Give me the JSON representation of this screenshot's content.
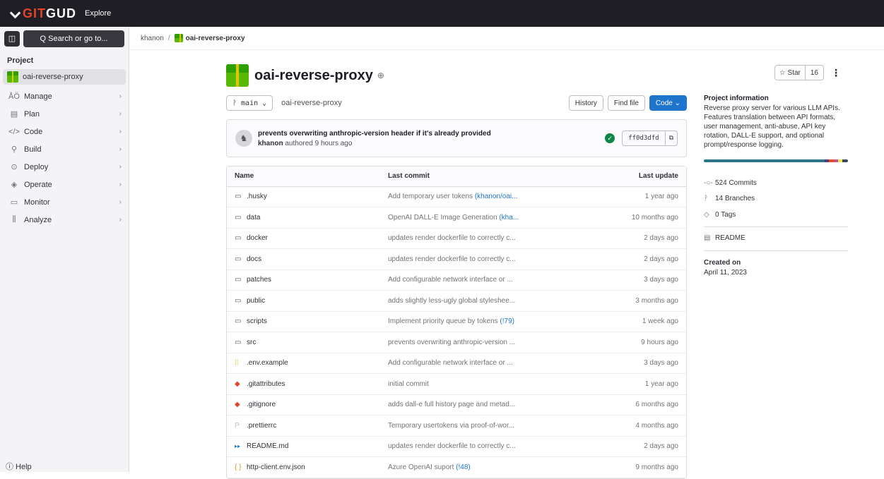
{
  "topbar": {
    "brand_prefix": "",
    "brand_git": "GIT",
    "brand_rest": "GUD",
    "explore": "Explore"
  },
  "sidebar": {
    "search_label": "Q Search or go to...",
    "section": "Project",
    "project": "oai-reverse-proxy",
    "items": [
      {
        "label": "Manage",
        "icon": "users-icon",
        "glyph": "ÅÖ"
      },
      {
        "label": "Plan",
        "icon": "calendar-icon",
        "glyph": "▤"
      },
      {
        "label": "Code",
        "icon": "code-icon",
        "glyph": "</>"
      },
      {
        "label": "Build",
        "icon": "rocket-icon",
        "glyph": "⚲"
      },
      {
        "label": "Deploy",
        "icon": "deploy-icon",
        "glyph": "⊙"
      },
      {
        "label": "Operate",
        "icon": "cloud-icon",
        "glyph": "◈"
      },
      {
        "label": "Monitor",
        "icon": "monitor-icon",
        "glyph": "▭"
      },
      {
        "label": "Analyze",
        "icon": "chart-icon",
        "glyph": "⫼"
      }
    ],
    "help": "ⓘ Help"
  },
  "breadcrumb": {
    "owner": "khanon",
    "separator": "/",
    "project": "oai-reverse-proxy"
  },
  "project": {
    "title": "oai-reverse-proxy",
    "branch": "main",
    "path": "oai-reverse-proxy",
    "history_label": "History",
    "find_file_label": "Find file",
    "code_label": "Code ⌄"
  },
  "last_commit": {
    "title": "prevents overwriting anthropic-version header if it's already provided",
    "author": "khanon",
    "meta": "authored 9 hours ago",
    "sha": "ff0d3dfd",
    "status": "passed"
  },
  "table": {
    "headers": {
      "name": "Name",
      "commit": "Last commit",
      "update": "Last update"
    },
    "rows": [
      {
        "name": ".husky",
        "type": "folder",
        "msg": "Add temporary user tokens ",
        "link": "(khanon/oai...",
        "updated": "1 year ago"
      },
      {
        "name": "data",
        "type": "folder",
        "msg": "OpenAI DALL-E Image Generation ",
        "link": "(kha...",
        "updated": "10 months ago"
      },
      {
        "name": "docker",
        "type": "folder",
        "msg": "updates render dockerfile to correctly c...",
        "link": "",
        "updated": "2 days ago"
      },
      {
        "name": "docs",
        "type": "folder",
        "msg": "updates render dockerfile to correctly c...",
        "link": "",
        "updated": "2 days ago"
      },
      {
        "name": "patches",
        "type": "folder",
        "msg": "Add configurable network interface or ...",
        "link": "",
        "updated": "3 days ago"
      },
      {
        "name": "public",
        "type": "folder",
        "msg": "adds slightly less-ugly global styleshee...",
        "link": "",
        "updated": "3 months ago"
      },
      {
        "name": "scripts",
        "type": "folder",
        "msg": "Implement priority queue by tokens ",
        "link": "(!79)",
        "updated": "1 week ago"
      },
      {
        "name": "src",
        "type": "folder",
        "msg": "prevents overwriting anthropic-version ...",
        "link": "",
        "updated": "9 hours ago"
      },
      {
        "name": ".env.example",
        "type": "env",
        "msg": "Add configurable network interface or ...",
        "link": "",
        "updated": "3 days ago"
      },
      {
        "name": ".gitattributes",
        "type": "git",
        "msg": "initial commit",
        "link": "",
        "updated": "1 year ago"
      },
      {
        "name": ".gitignore",
        "type": "git",
        "msg": "adds dall-e full history page and metad...",
        "link": "",
        "updated": "6 months ago"
      },
      {
        "name": ".prettierrc",
        "type": "prettier",
        "msg": "Temporary usertokens via proof-of-wor...",
        "link": "",
        "updated": "4 months ago"
      },
      {
        "name": "README.md",
        "type": "markdown",
        "msg": "updates render dockerfile to correctly c...",
        "link": "",
        "updated": "2 days ago"
      },
      {
        "name": "http-client.env.json",
        "type": "json",
        "msg": "Azure OpenAI suport ",
        "link": "(!48)",
        "updated": "9 months ago"
      }
    ]
  },
  "right": {
    "star_label": "☆ Star",
    "star_count": "16",
    "info_title": "Project information",
    "info_desc": "Reverse proxy server for various LLM APIs. Features translation between API formats, user management, anti-abuse, API key rotation, DALL-E support, and optional prompt/response logging.",
    "languages": [
      {
        "color": "#2b7489",
        "share": 0.84
      },
      {
        "color": "#563d7c",
        "share": 0.03
      },
      {
        "color": "#e34c26",
        "share": 0.03
      },
      {
        "color": "#c6538c",
        "share": 0.03
      },
      {
        "color": "#f1e05a",
        "share": 0.03
      },
      {
        "color": "#384d54",
        "share": 0.04
      }
    ],
    "commits": "524 Commits",
    "branches": "14 Branches",
    "tags": "0 Tags",
    "readme": "README",
    "created_label": "Created on",
    "created_value": "April 11, 2023"
  }
}
